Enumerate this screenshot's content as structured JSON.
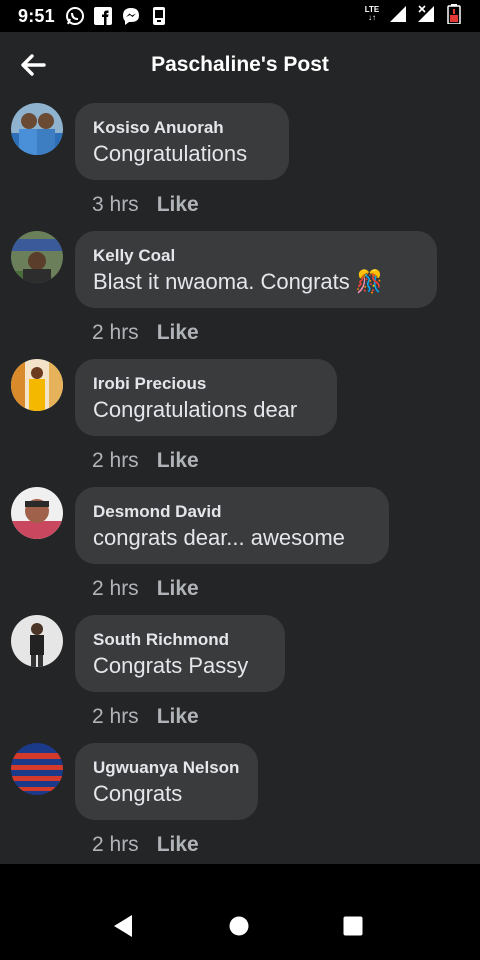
{
  "status": {
    "time": "9:51",
    "network_label": "LTE"
  },
  "header": {
    "title": "Paschaline's Post"
  },
  "comments": [
    {
      "name": "Kosiso Anuorah",
      "text": "Congratulations",
      "time": "3 hrs",
      "like": "Like",
      "avatar_color": "#2d6fb8"
    },
    {
      "name": "Kelly Coal",
      "text": "Blast it nwaoma. Congrats",
      "emoji": "🎊",
      "time": "2 hrs",
      "like": "Like",
      "avatar_color": "#4a6b3a"
    },
    {
      "name": "Irobi Precious",
      "text": "Congratulations dear",
      "time": "2 hrs",
      "like": "Like",
      "avatar_color": "#e8a21c"
    },
    {
      "name": "Desmond David",
      "text": "congrats dear... awesome",
      "time": "2 hrs",
      "like": "Like",
      "avatar_color": "#c9485f"
    },
    {
      "name": "South Richmond",
      "text": "Congrats Passy",
      "time": "2 hrs",
      "like": "Like",
      "avatar_color": "#cfcfcf"
    },
    {
      "name": "Ugwuanya Nelson",
      "text": "Congrats",
      "time": "2 hrs",
      "like": "Like",
      "avatar_color": "#1c3a8a"
    }
  ],
  "colors": {
    "background": "#242526",
    "bubble": "#3a3b3c",
    "secondary_text": "#b0b3b8"
  }
}
